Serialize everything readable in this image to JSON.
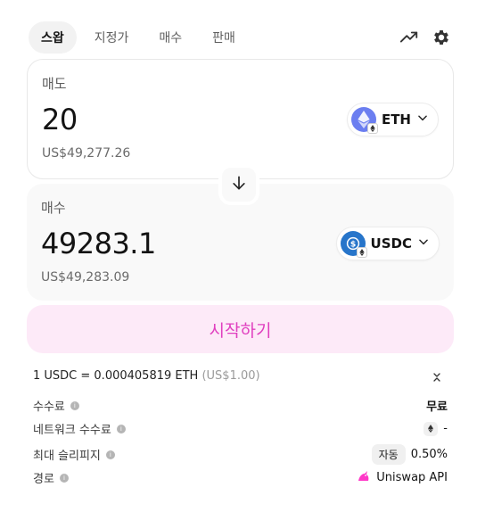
{
  "tabs": [
    {
      "label": "스왑",
      "active": true
    },
    {
      "label": "지정가",
      "active": false
    },
    {
      "label": "매수",
      "active": false
    },
    {
      "label": "판매",
      "active": false
    }
  ],
  "icons": {
    "chart": "trending-up-icon",
    "settings": "gear-icon"
  },
  "sell": {
    "label": "매도",
    "amount": "20",
    "usd_value": "US$49,277.26",
    "token": "ETH"
  },
  "buy": {
    "label": "매수",
    "amount": "49283.1",
    "usd_value": "US$49,283.09",
    "token": "USDC"
  },
  "start_button": "시작하기",
  "rate": {
    "text": "1 USDC = 0.000405819 ETH",
    "usd": "(US$1.00)"
  },
  "details": {
    "fee_label": "수수료",
    "fee_value": "무료",
    "network_fee_label": "네트워크 수수료",
    "network_fee_value": "-",
    "slippage_label": "최대 슬리피지",
    "slippage_badge": "자동",
    "slippage_value": "0.50%",
    "route_label": "경로",
    "route_value": "Uniswap API"
  },
  "colors": {
    "accent": "#e03fbf",
    "start_button_bg": "#fdeaf8",
    "eth": "#6b7ef0",
    "usdc": "#2775ca"
  }
}
